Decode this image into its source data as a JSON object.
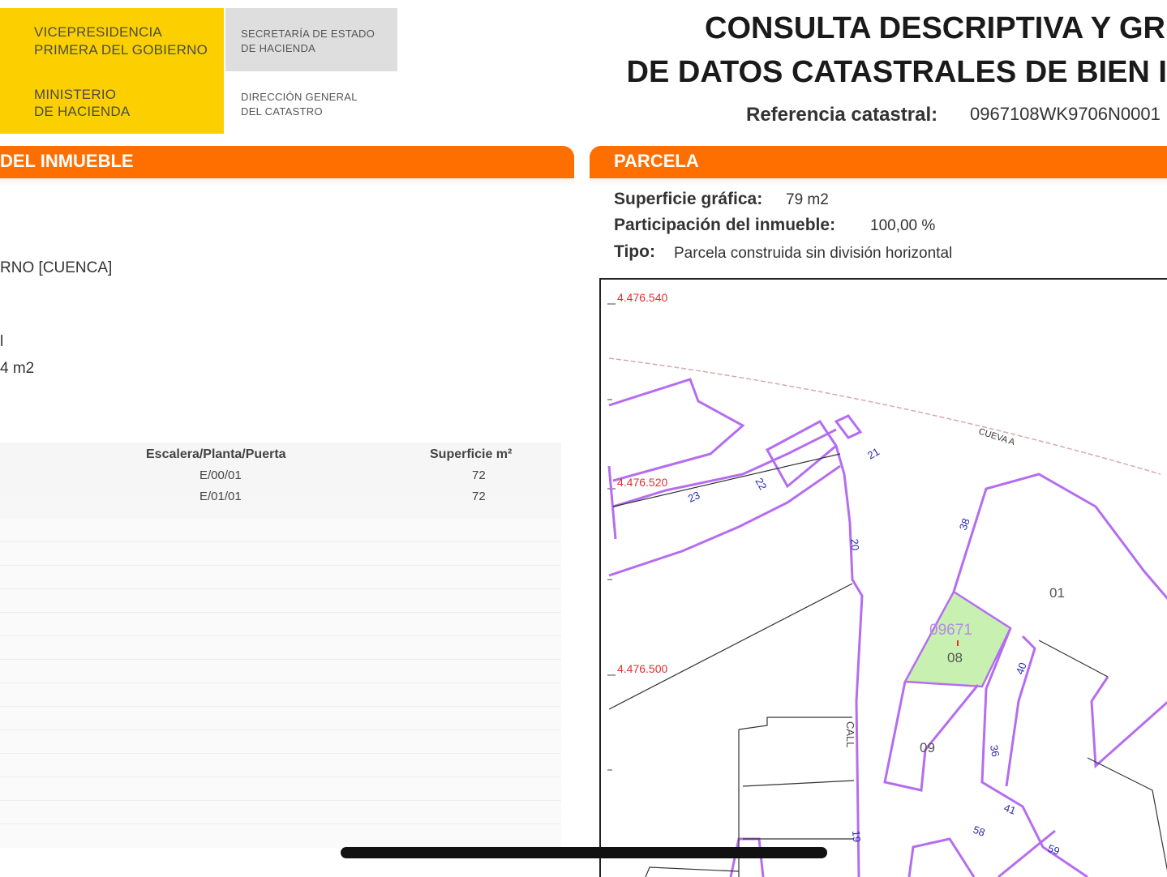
{
  "header": {
    "gov_lines": [
      "VICEPRESIDENCIA",
      "PRIMERA DEL GOBIERNO",
      "MINISTERIO",
      "DE HACIENDA"
    ],
    "secretaria_lines": [
      "SECRETARÍA DE ESTADO",
      "DE HACIENDA"
    ],
    "direccion_lines": [
      "DIRECCIÓN GENERAL",
      "DEL CATASTRO"
    ],
    "title_lines": [
      "CONSULTA DESCRIPTIVA Y GR",
      "DE DATOS CATASTRALES DE BIEN I"
    ],
    "ref_label": "Referencia catastral:",
    "ref_value": "0967108WK9706N0001"
  },
  "left_section": {
    "bar_title": "DEL INMUEBLE",
    "location_fragment": "RNO [CUENCA]",
    "fragment_1": "l",
    "fragment_2": "4 m2",
    "table": {
      "headers": [
        "Escalera/Planta/Puerta",
        "Superficie m²"
      ],
      "rows": [
        {
          "escalera": "E/00/01",
          "superficie": "72"
        },
        {
          "escalera": "E/01/01",
          "superficie": "72"
        }
      ]
    }
  },
  "parcela": {
    "bar_title": "PARCELA",
    "superficie_label": "Superficie gráfica:",
    "superficie_value": "79 m2",
    "participacion_label": "Participación del inmueble:",
    "participacion_value": "100,00 %",
    "tipo_label": "Tipo:",
    "tipo_value": "Parcela construida sin división horizontal"
  },
  "map": {
    "coords": [
      "4.476.540",
      "4.476.520",
      "4.476.500"
    ],
    "street": "CUEVA A",
    "parcel_main": "09671",
    "parcel_sub": "08",
    "parcel_labels": [
      "01",
      "09"
    ],
    "house_numbers": [
      "21",
      "22",
      "23",
      "20",
      "38",
      "40",
      "36",
      "41",
      "58",
      "59",
      "19",
      "CALL"
    ],
    "colors": {
      "parcel_line": "#b56df0",
      "highlight": "#c8f0b0",
      "coord": "#e03030",
      "number": "#2a2ab0"
    }
  }
}
